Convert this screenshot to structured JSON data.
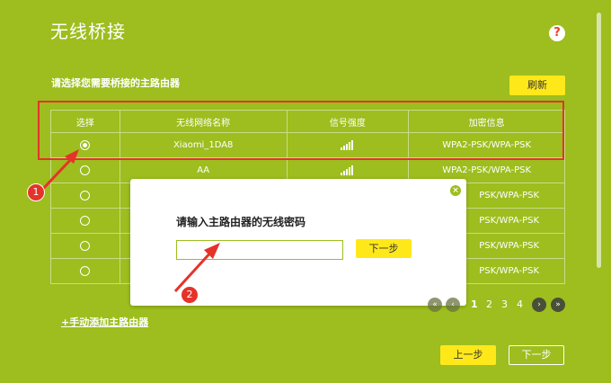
{
  "page": {
    "title": "无线桥接",
    "help_glyph": "?"
  },
  "section": {
    "subtitle": "请选择您需要桥接的主路由器",
    "refresh_label": "刷新"
  },
  "table": {
    "headers": [
      "选择",
      "无线网络名称",
      "信号强度",
      "加密信息"
    ],
    "rows": [
      {
        "ssid": "Xiaomi_1DA8",
        "security": "WPA2-PSK/WPA-PSK",
        "selected": true,
        "signal_bars": 5
      },
      {
        "ssid": "AA",
        "security": "WPA2-PSK/WPA-PSK",
        "selected": false,
        "signal_bars": 5
      },
      {
        "ssid": "",
        "security": "PSK/WPA-PSK",
        "selected": false,
        "signal_bars": 5
      },
      {
        "ssid": "",
        "security": "PSK/WPA-PSK",
        "selected": false,
        "signal_bars": 5
      },
      {
        "ssid": "",
        "security": "PSK/WPA-PSK",
        "selected": false,
        "signal_bars": 5
      },
      {
        "ssid": "",
        "security": "PSK/WPA-PSK",
        "selected": false,
        "signal_bars": 5
      }
    ]
  },
  "modal": {
    "title": "请输入主路由器的无线密码",
    "password_value": "",
    "next_label": "下一步",
    "close_glyph": "×"
  },
  "pagination": {
    "pages": [
      "1",
      "2",
      "3",
      "4"
    ],
    "current_page": "1"
  },
  "annotations": {
    "badge1": "1",
    "badge2": "2"
  },
  "footer": {
    "add_manual_label": "+手动添加主路由器",
    "prev_label": "上一步",
    "next_label": "下一步"
  },
  "colors": {
    "background": "#9dbe1e",
    "accent_button": "#ffe81a",
    "annotation_red": "#e5332a"
  }
}
